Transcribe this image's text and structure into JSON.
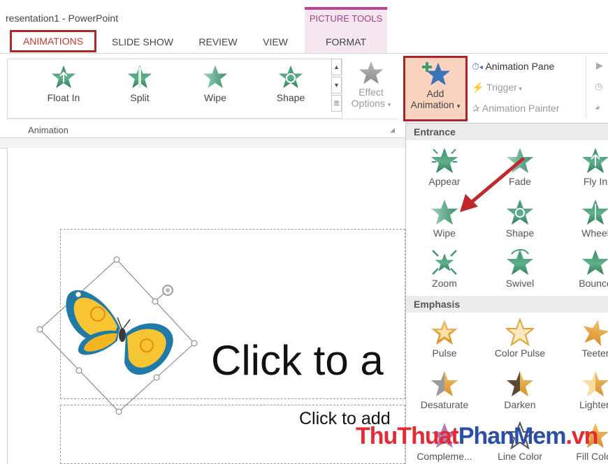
{
  "window": {
    "title": "resentation1 - PowerPoint"
  },
  "contextual": {
    "label": "PICTURE TOOLS"
  },
  "tabs": [
    {
      "label": "ANIMATIONS"
    },
    {
      "label": "SLIDE SHOW"
    },
    {
      "label": "REVIEW"
    },
    {
      "label": "VIEW"
    },
    {
      "label": "FORMAT"
    }
  ],
  "ribbon": {
    "gallery": [
      {
        "label": "Float In",
        "icon": "star-float-in-icon"
      },
      {
        "label": "Split",
        "icon": "star-split-icon"
      },
      {
        "label": "Wipe",
        "icon": "star-wipe-icon"
      },
      {
        "label": "Shape",
        "icon": "star-shape-icon"
      }
    ],
    "effect_options": {
      "line1": "Effect",
      "line2": "Options"
    },
    "group_label": "Animation",
    "add_animation": {
      "line1": "Add",
      "line2": "Animation"
    },
    "advanced": [
      {
        "label": "Animation Pane",
        "enabled": true
      },
      {
        "label": "Trigger",
        "enabled": false
      },
      {
        "label": "Animation Painter",
        "enabled": false
      }
    ]
  },
  "slide": {
    "title_placeholder": "Click to a",
    "subtitle_placeholder": "Click to add"
  },
  "panel": {
    "entrance_header": "Entrance",
    "entrance": [
      "Appear",
      "Fade",
      "Fly In",
      "Wipe",
      "Shape",
      "Wheel",
      "Zoom",
      "Swivel",
      "Bounce"
    ],
    "emphasis_header": "Emphasis",
    "emphasis": [
      "Pulse",
      "Color Pulse",
      "Teeter",
      "Desaturate",
      "Darken",
      "Lighten",
      "Compleme...",
      "Line Color",
      "Fill Color"
    ]
  },
  "watermark": {
    "part1": "ThuThuat",
    "part2": "PhanMem",
    "part3": ".vn"
  },
  "colors": {
    "accent_red": "#b02a25",
    "star_green": "#3f9a72",
    "star_gold": "#e0a33a",
    "context_pink": "#b84592"
  }
}
